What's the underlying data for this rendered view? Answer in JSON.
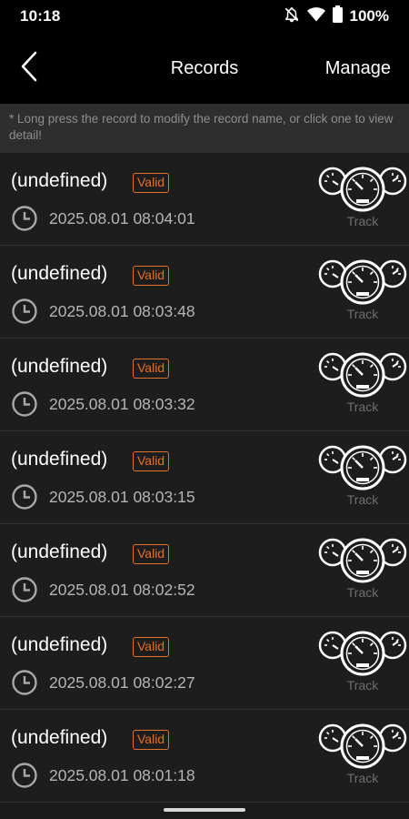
{
  "status_bar": {
    "time": "10:18",
    "battery": "100%",
    "icons": [
      "notifications-off-icon",
      "wifi-icon",
      "battery-icon"
    ]
  },
  "app_bar": {
    "back_icon": "chevron-left-icon",
    "title": "Records",
    "manage_label": "Manage"
  },
  "hint": "* Long press the record to modify the record name, or click one to view detail!",
  "colors": {
    "accent": "#e0702b",
    "background": "#1d1d1d",
    "header": "#000000",
    "hint_background": "#2e2e2e"
  },
  "records": [
    {
      "name": "(undefined)",
      "status": "Valid",
      "datetime": "2025.08.01 08:04:01",
      "action": "Track"
    },
    {
      "name": "(undefined)",
      "status": "Valid",
      "datetime": "2025.08.01 08:03:48",
      "action": "Track"
    },
    {
      "name": "(undefined)",
      "status": "Valid",
      "datetime": "2025.08.01 08:03:32",
      "action": "Track"
    },
    {
      "name": "(undefined)",
      "status": "Valid",
      "datetime": "2025.08.01 08:03:15",
      "action": "Track"
    },
    {
      "name": "(undefined)",
      "status": "Valid",
      "datetime": "2025.08.01 08:02:52",
      "action": "Track"
    },
    {
      "name": "(undefined)",
      "status": "Valid",
      "datetime": "2025.08.01 08:02:27",
      "action": "Track"
    },
    {
      "name": "(undefined)",
      "status": "Valid",
      "datetime": "2025.08.01 08:01:18",
      "action": "Track"
    }
  ]
}
